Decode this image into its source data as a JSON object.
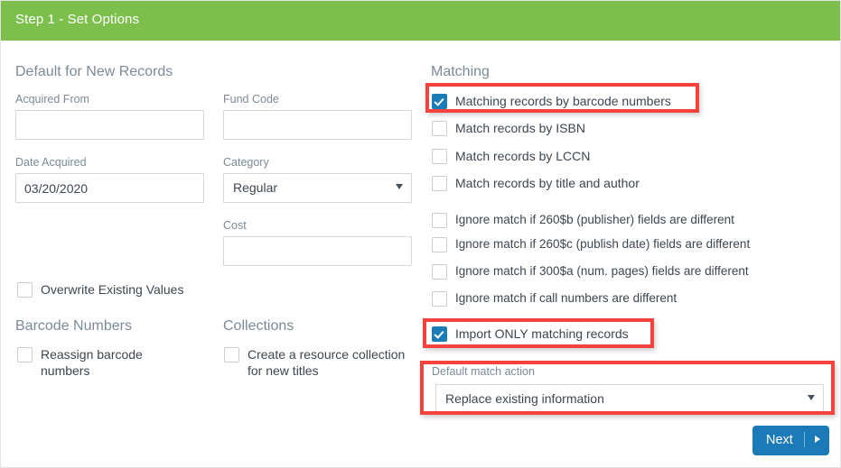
{
  "header": {
    "title": "Step 1 - Set Options",
    "background_color": "#7cbf4c"
  },
  "colors": {
    "header_green": "#7cbf4c",
    "checkbox_blue": "#1c7cb8",
    "highlight_red": "#f4433c",
    "button_blue": "#1b7bb9",
    "label_gray": "#7b8a99",
    "text_dark": "#3c4650"
  },
  "left_column": {
    "defaults_section": {
      "heading": "Default for New Records",
      "fields": [
        {
          "label": "Acquired From",
          "value": "",
          "placeholder": ""
        },
        {
          "label": "Fund Code",
          "value": "",
          "placeholder": ""
        },
        {
          "label": "Date Acquired",
          "value": "03/20/2020",
          "placeholder": ""
        },
        {
          "label": "Cost",
          "value": "",
          "placeholder": ""
        }
      ],
      "category": {
        "label": "Category",
        "selected": "Regular",
        "caret_icon": "chevron-down-icon"
      },
      "overwrite_checkbox": {
        "label": "Overwrite Existing Values",
        "checked": false
      }
    },
    "barcode_section": {
      "heading": "Barcode Numbers",
      "checkbox": {
        "label": "Reassign barcode numbers",
        "checked": false
      }
    },
    "collections_section": {
      "heading": "Collections",
      "checkbox": {
        "label": "Create a resource collection for new titles",
        "checked": false
      }
    }
  },
  "right_column": {
    "matching_section": {
      "heading": "Matching",
      "primary_options": [
        {
          "label": "Matching records by barcode numbers",
          "checked": true,
          "highlighted": true
        },
        {
          "label": "Match records by ISBN",
          "checked": false,
          "highlighted": false
        },
        {
          "label": "Match records by LCCN",
          "checked": false,
          "highlighted": false
        },
        {
          "label": "Match records by title and author",
          "checked": false,
          "highlighted": false
        }
      ],
      "ignore_options": [
        {
          "label": "Ignore match if 260$b (publisher) fields are different",
          "checked": false
        },
        {
          "label": "Ignore match if 260$c (publish date) fields are different",
          "checked": false
        },
        {
          "label": "Ignore match if 300$a (num. pages) fields are different",
          "checked": false
        },
        {
          "label": "Ignore match if call numbers are different",
          "checked": false
        }
      ],
      "import_only": {
        "label": "Import ONLY matching records",
        "checked": true,
        "highlighted": true
      },
      "default_match_action": {
        "label": "Default match action",
        "selected": "Replace existing information",
        "caret_icon": "chevron-down-icon",
        "highlighted": true
      }
    }
  },
  "footer": {
    "next_button": {
      "label": "Next",
      "arrow_icon": "arrow-right-icon"
    }
  }
}
